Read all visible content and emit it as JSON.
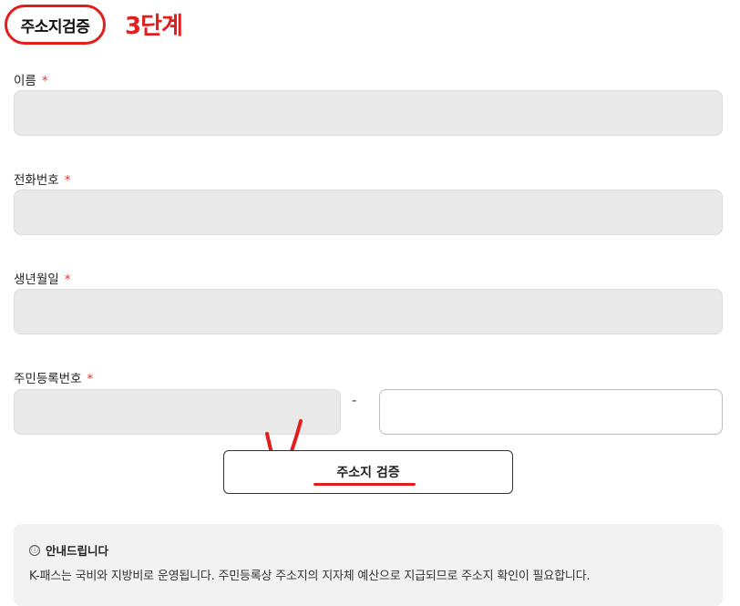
{
  "header": {
    "title": "주소지검증",
    "step": "3단계"
  },
  "form": {
    "name_label": "이름",
    "phone_label": "전화번호",
    "birth_label": "생년월일",
    "rrn_label": "주민등록번호",
    "required_mark": "*",
    "rrn_separator": "-"
  },
  "button": {
    "verify_label": "주소지 검증"
  },
  "notice": {
    "info_icon": "ⓘ",
    "title": "안내드립니다",
    "body": "K-패스는 국비와 지방비로 운영됩니다. 주민등록상 주소지의 지자체 예산으로 지급되므로 주소지 확인이 필요합니다."
  },
  "colors": {
    "accent_red": "#e11d1d",
    "field_bg": "#e9e9e9"
  }
}
